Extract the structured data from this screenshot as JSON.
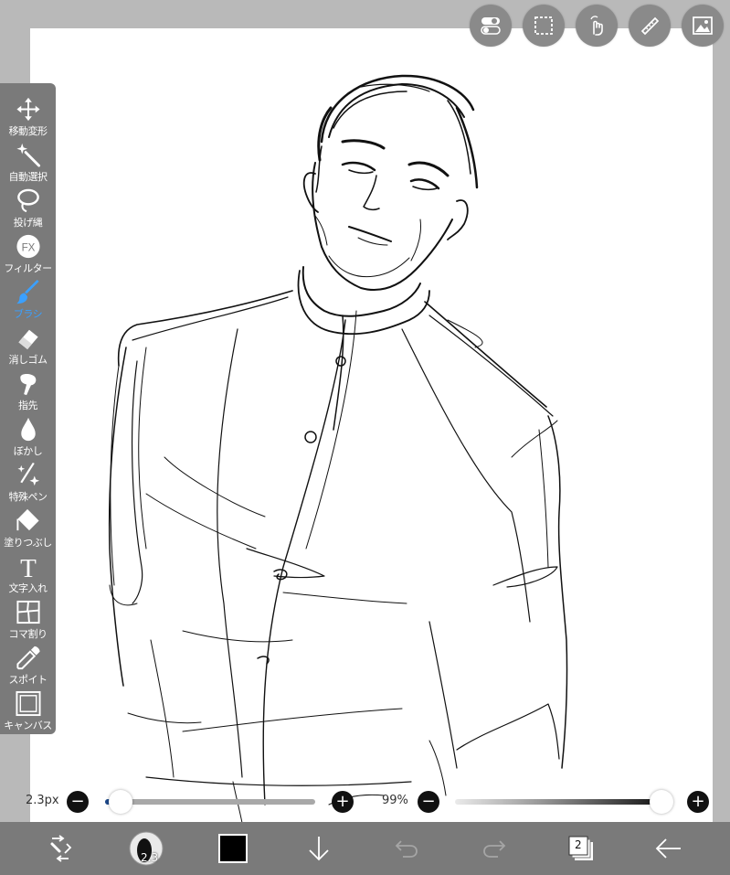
{
  "tools": [
    {
      "id": "move",
      "label": "移動変形",
      "icon": "move-arrows-icon"
    },
    {
      "id": "magic",
      "label": "自動選択",
      "icon": "magic-wand-icon"
    },
    {
      "id": "lasso",
      "label": "投げ縄",
      "icon": "lasso-icon"
    },
    {
      "id": "filter",
      "label": "フィルター",
      "icon": "fx-icon",
      "glyph": "FX"
    },
    {
      "id": "brush",
      "label": "ブラシ",
      "icon": "brush-icon",
      "active": true
    },
    {
      "id": "eraser",
      "label": "消しゴム",
      "icon": "eraser-icon"
    },
    {
      "id": "finger",
      "label": "指先",
      "icon": "finger-icon"
    },
    {
      "id": "blur",
      "label": "ぼかし",
      "icon": "blur-drop-icon"
    },
    {
      "id": "special",
      "label": "特殊ペン",
      "icon": "sparkle-pen-icon"
    },
    {
      "id": "fill",
      "label": "塗りつぶし",
      "icon": "fill-bucket-icon"
    },
    {
      "id": "text",
      "label": "文字入れ",
      "icon": "text-icon",
      "glyph": "T"
    },
    {
      "id": "frame",
      "label": "コマ割り",
      "icon": "frame-divide-icon"
    },
    {
      "id": "eyedropper",
      "label": "スポイト",
      "icon": "eyedropper-icon"
    },
    {
      "id": "canvas",
      "label": "キャンバス",
      "icon": "canvas-icon"
    }
  ],
  "top_toolbar": [
    "toggle-icon",
    "selection-icon",
    "touch-gesture-icon",
    "ruler-icon",
    "image-layer-icon"
  ],
  "brush_size": {
    "label": "2.3px",
    "value": 0.02
  },
  "opacity": {
    "label": "99%",
    "value": 0.99
  },
  "bottom_bar": {
    "brush_badge": "2.3",
    "layer_count": "2",
    "color_swatch": "#000000"
  },
  "colors": {
    "accent": "#3aa0ff",
    "palette_bg": "#7a7a7a",
    "frame_bg": "#b9b9b9"
  }
}
